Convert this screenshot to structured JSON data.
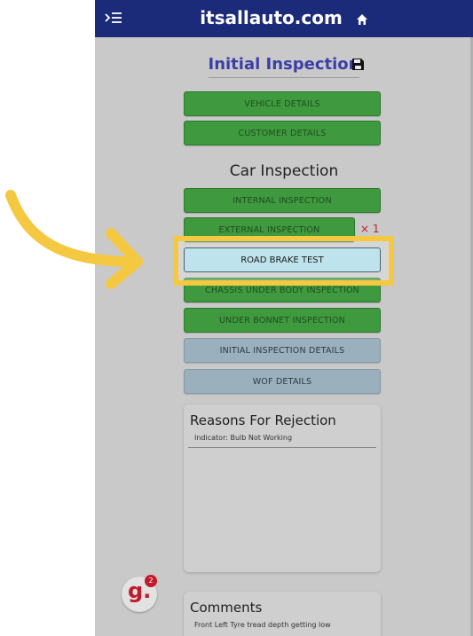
{
  "header": {
    "site_name": "itsallauto.com",
    "menu_icon": "menu-collapse-icon",
    "home_icon": "home-icon",
    "color": "#1b2b7a"
  },
  "page": {
    "title": "Initial Inspection",
    "save_icon": "save-icon"
  },
  "buttons_top": [
    {
      "label": "VEHICLE DETAILS"
    },
    {
      "label": "CUSTOMER DETAILS"
    }
  ],
  "car_inspection": {
    "heading": "Car Inspection",
    "buttons": [
      {
        "label": "INTERNAL INSPECTION"
      },
      {
        "label": "EXTERNAL INSPECTION",
        "fault_count": "× 1"
      },
      {
        "label": "ROAD BRAKE TEST"
      },
      {
        "label": "CHASSIS UNDER BODY INSPECTION"
      },
      {
        "label": "UNDER BONNET INSPECTION"
      },
      {
        "label": "INITIAL INSPECTION DETAILS"
      },
      {
        "label": "WOF DETAILS"
      }
    ]
  },
  "reasons": {
    "heading": "Reasons For Rejection",
    "items": [
      "Indicator: Bulb Not Working"
    ]
  },
  "comments": {
    "heading": "Comments",
    "items": [
      "Front Left Tyre tread depth getting low"
    ]
  },
  "badge": {
    "letter": "g.",
    "count": "2"
  },
  "colors": {
    "green_button": "#3f9a3f",
    "gray_button": "#9ab0bd",
    "highlight": "#f5c842",
    "fault": "#c0202a"
  }
}
